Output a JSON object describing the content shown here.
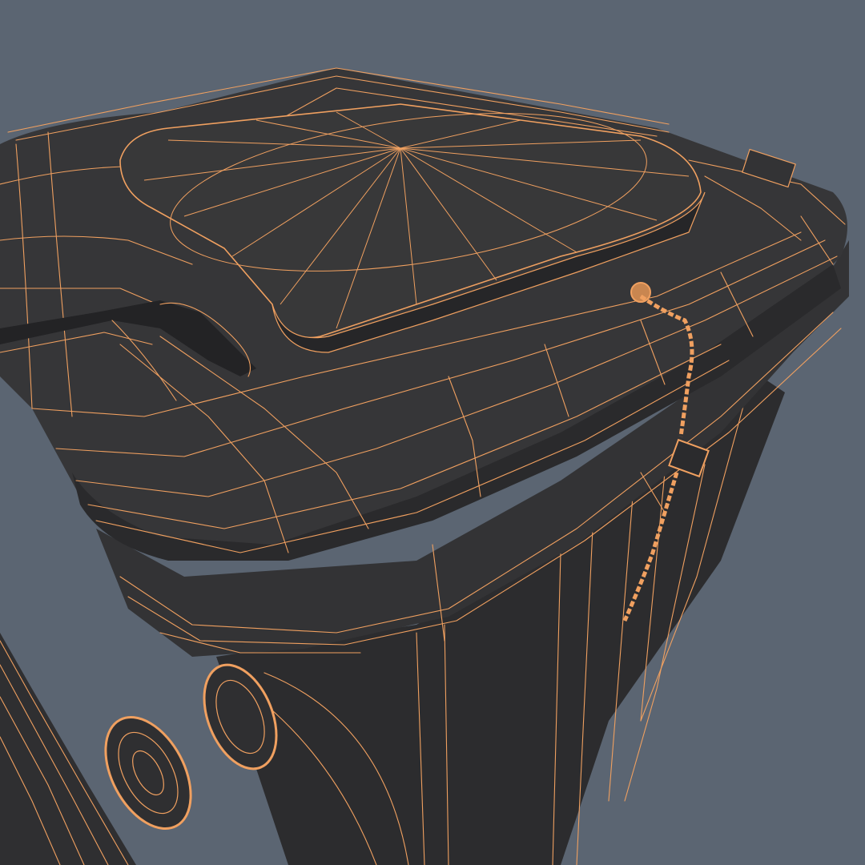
{
  "scene": {
    "subject": "wheelie-bin-wireframe-render",
    "colors": {
      "background": "#5b6572",
      "body": "#2f2f31",
      "body_light": "#3a3a3c",
      "body_shadow": "#222224",
      "wire": "#f0a060",
      "wire_dim": "#c98650"
    },
    "icons": [
      "lid-mesh",
      "handle-mesh",
      "chain-mesh",
      "wheel-mesh",
      "second-bin-mesh"
    ]
  }
}
